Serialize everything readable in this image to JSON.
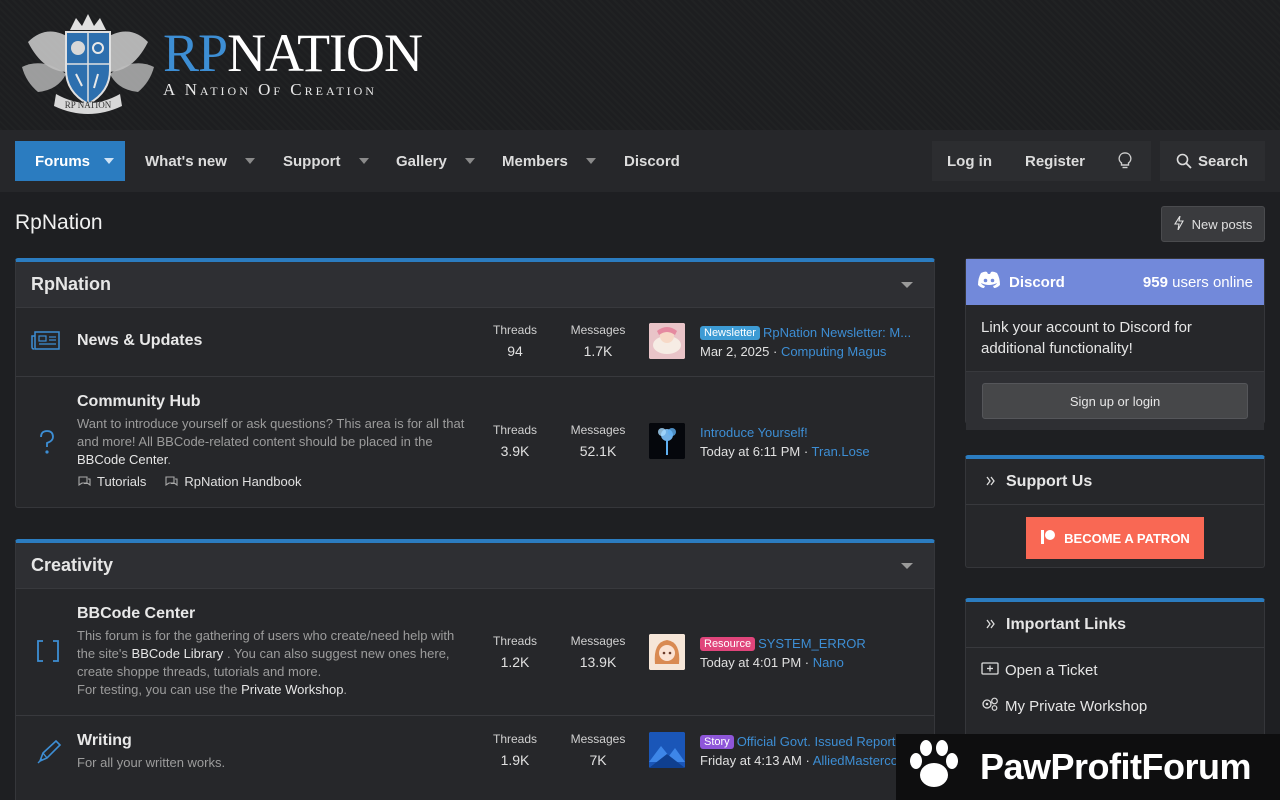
{
  "brand": {
    "logo_rp": "RP",
    "logo_nation": "NATION",
    "tagline": "A Nation Of Creation",
    "emblem_text": "RP NATION"
  },
  "nav": {
    "items": [
      {
        "label": "Forums",
        "active": true,
        "has_menu": true
      },
      {
        "label": "What's new",
        "has_menu": true
      },
      {
        "label": "Support",
        "has_menu": true
      },
      {
        "label": "Gallery",
        "has_menu": true
      },
      {
        "label": "Members",
        "has_menu": true
      },
      {
        "label": "Discord",
        "has_menu": false
      }
    ],
    "login": "Log in",
    "register": "Register",
    "theme_icon": "lightbulb-icon",
    "search": "Search"
  },
  "page": {
    "title": "RpNation",
    "new_posts": "New posts"
  },
  "categories": [
    {
      "title": "RpNation",
      "nodes": [
        {
          "icon": "newspaper-icon",
          "title": "News & Updates",
          "threads_label": "Threads",
          "threads": "94",
          "messages_label": "Messages",
          "messages": "1.7K",
          "last_prefix": "Newsletter",
          "last_title": "RpNation Newsletter: M...",
          "last_date": "Mar 2, 2025",
          "last_user": "Computing Magus"
        },
        {
          "icon": "question-icon",
          "title": "Community Hub",
          "desc": "Want to introduce yourself or ask questions? This area is for all that and more! All BBCode-related content should be placed in the",
          "desc_link": "BBCode Center",
          "desc_end": ".",
          "subforums": [
            "Tutorials",
            "RpNation Handbook"
          ],
          "threads_label": "Threads",
          "threads": "3.9K",
          "messages_label": "Messages",
          "messages": "52.1K",
          "last_title": "Introduce Yourself!",
          "last_date": "Today at 6:11 PM",
          "last_user": "Tran.Lose"
        }
      ]
    },
    {
      "title": "Creativity",
      "nodes": [
        {
          "icon": "brackets-icon",
          "title": "BBCode Center",
          "desc_a": "This forum is for the gathering of users who create/need help with the site's",
          "desc_link_a": "BBCode Library",
          "desc_b": ". You can also suggest new ones here, create shoppe threads, tutorials and more.",
          "desc_c": "For testing, you can use the",
          "desc_link_b": "Private Workshop",
          "desc_d": ".",
          "threads_label": "Threads",
          "threads": "1.2K",
          "messages_label": "Messages",
          "messages": "13.9K",
          "last_prefix": "Resource",
          "last_title": "SYSTEM_ERROR",
          "last_date": "Today at 4:01 PM",
          "last_user": "Nano"
        },
        {
          "icon": "pen-icon",
          "title": "Writing",
          "desc": "For all your written works.",
          "threads_label": "Threads",
          "threads": "1.9K",
          "messages_label": "Messages",
          "messages": "7K",
          "last_prefix": "Story",
          "last_title": "Official Govt. Issued Report",
          "last_date": "Friday at 4:13 AM",
          "last_user": "AlliedMastercomputer"
        }
      ]
    }
  ],
  "sidebar": {
    "discord": {
      "name": "Discord",
      "online_count": "959",
      "online_label": "users online",
      "body": "Link your account to Discord for additional functionality!",
      "button": "Sign up or login"
    },
    "support": {
      "title": "Support Us",
      "patron": "BECOME A PATRON"
    },
    "links": {
      "title": "Important Links",
      "items": [
        "Open a Ticket",
        "My Private Workshop"
      ]
    }
  },
  "watermark": {
    "text": "PawProfitForum"
  },
  "colors": {
    "accent": "#2b7cc0",
    "link": "#3d8ed4",
    "discord": "#7289da",
    "patreon": "#f96854",
    "prefix_newsletter": "#3d9bd4",
    "prefix_resource": "#e0457b",
    "prefix_story": "#8e56d9"
  }
}
